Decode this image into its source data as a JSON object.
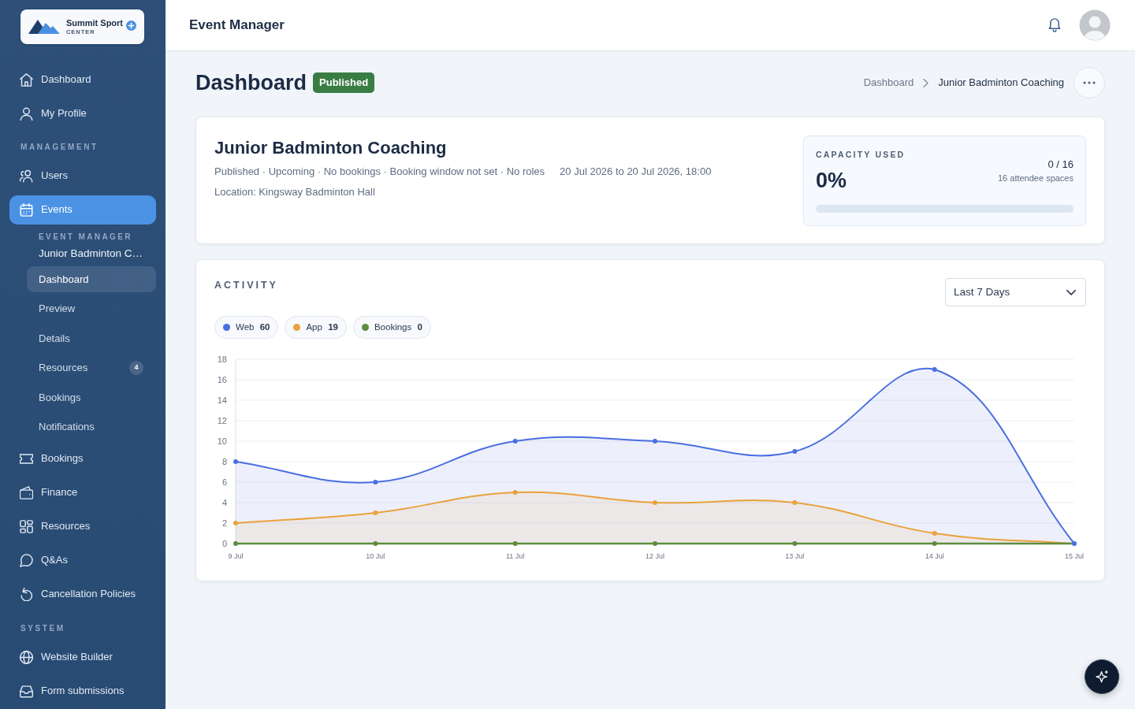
{
  "sidebar": {
    "logo": {
      "name": "Summit Sport",
      "tagline": "CENTER"
    },
    "items": [
      {
        "kind": "link",
        "label": "Dashboard",
        "selected": false
      },
      {
        "kind": "link",
        "label": "My Profile",
        "selected": false
      },
      {
        "kind": "heading",
        "label": "MANAGEMENT"
      },
      {
        "kind": "link",
        "label": "Users",
        "selected": false
      },
      {
        "kind": "link",
        "label": "Events",
        "selected": true,
        "submenu": {
          "heading": "EVENT MANAGER",
          "title": "Junior Badminton C…",
          "items": [
            {
              "label": "Dashboard",
              "selected": true
            },
            {
              "label": "Preview",
              "selected": false
            },
            {
              "label": "Details",
              "selected": false
            },
            {
              "label": "Resources",
              "selected": false,
              "badge": "4"
            },
            {
              "label": "Bookings",
              "selected": false
            },
            {
              "label": "Notifications",
              "selected": false
            }
          ]
        }
      },
      {
        "kind": "link",
        "label": "Bookings",
        "selected": false
      },
      {
        "kind": "link",
        "label": "Finance",
        "selected": false
      },
      {
        "kind": "link",
        "label": "Resources",
        "selected": false
      },
      {
        "kind": "link",
        "label": "Q&As",
        "selected": false
      },
      {
        "kind": "link",
        "label": "Cancellation Policies",
        "selected": false
      },
      {
        "kind": "heading",
        "label": "SYSTEM"
      },
      {
        "kind": "link",
        "label": "Website Builder",
        "selected": false
      },
      {
        "kind": "link",
        "label": "Form submissions",
        "selected": false
      }
    ]
  },
  "header": {
    "title": "Event Manager"
  },
  "page": {
    "title": "Dashboard",
    "status_badge": "Published",
    "breadcrumb": [
      {
        "label": "Dashboard",
        "current": false
      },
      {
        "label": "Junior Badminton Coaching",
        "current": true
      }
    ]
  },
  "event": {
    "title": "Junior Badminton Coaching",
    "summary": "Published · Upcoming · No bookings · Booking window not set · No roles",
    "dates": "20 Jul 2026 to 20 Jul 2026, 18:00",
    "location": "Location: Kingsway Badminton Hall"
  },
  "capacity": {
    "label": "CAPACITY USED",
    "percent": "0%",
    "count": "0 / 16",
    "spaces": "16 attendee spaces",
    "level": 0
  },
  "activity": {
    "title": "ACTIVITY",
    "range": {
      "value": "Last 7 Days"
    },
    "legend": [
      {
        "count": "60"
      },
      {
        "count": "19"
      },
      {
        "count": "0"
      }
    ],
    "chart_data": {
      "type": "area",
      "categories": [
        "9 Jul",
        "10 Jul",
        "11 Jul",
        "12 Jul",
        "13 Jul",
        "14 Jul",
        "15 Jul"
      ],
      "series": [
        {
          "name": "Web",
          "color": "#4a6fe0",
          "values": [
            8,
            6,
            10,
            10,
            9,
            17,
            0
          ]
        },
        {
          "name": "App",
          "color": "#e9a23c",
          "values": [
            2,
            3,
            5,
            4,
            4,
            1,
            0
          ]
        },
        {
          "name": "Bookings",
          "color": "#5e8c3f",
          "values": [
            0,
            0,
            0,
            0,
            0,
            0,
            0
          ]
        }
      ],
      "ylim": [
        0,
        18
      ],
      "yticks": [
        0,
        2,
        4,
        6,
        8,
        10,
        12,
        14,
        16,
        18
      ],
      "grid": true
    }
  }
}
